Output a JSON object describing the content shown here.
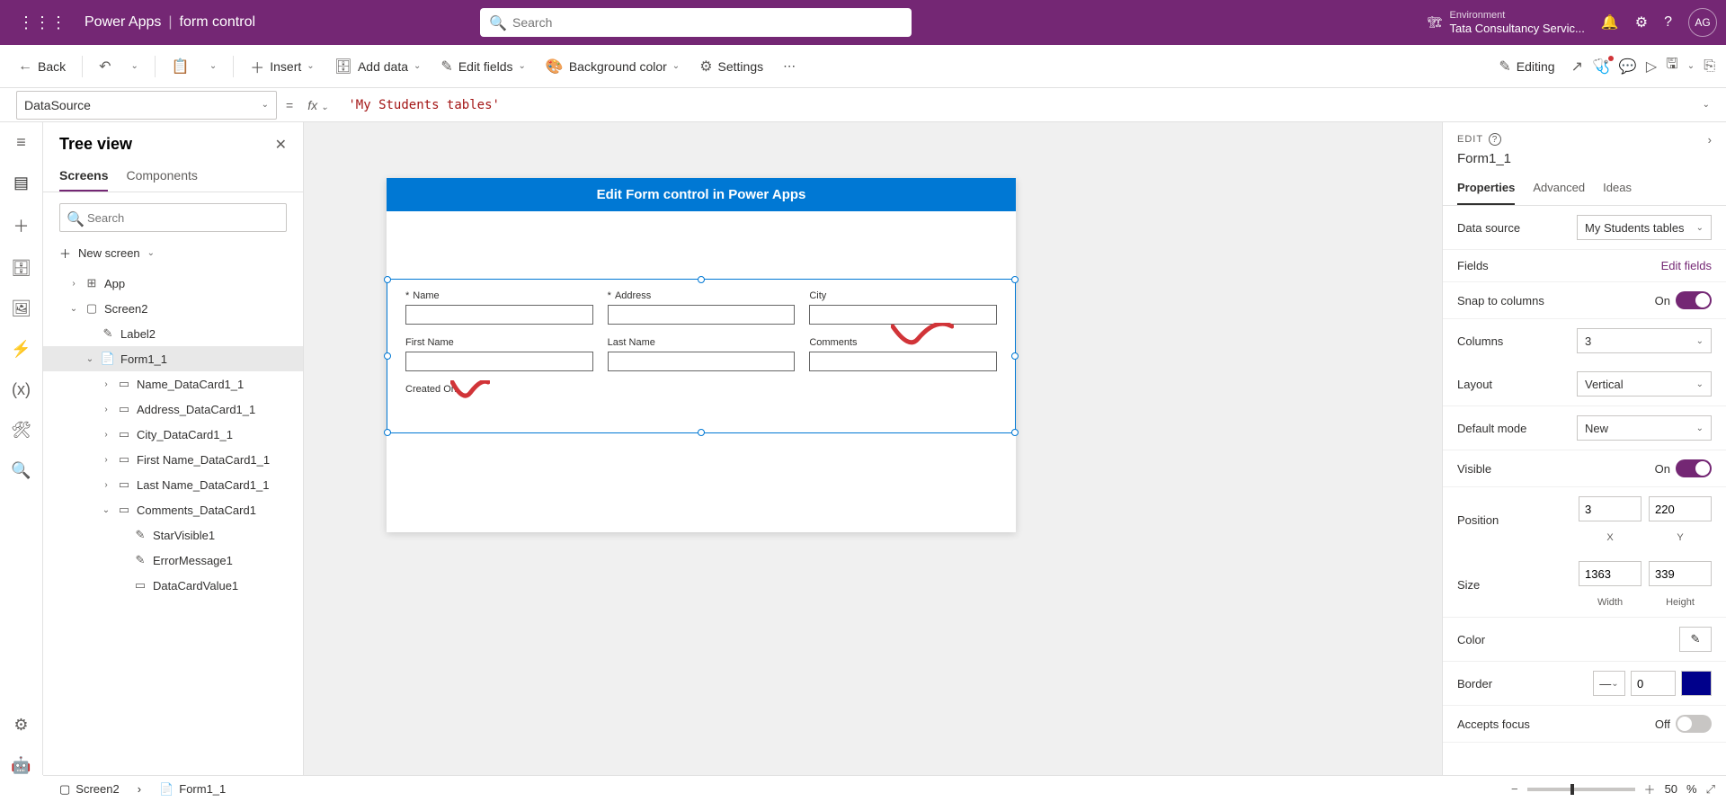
{
  "topbar": {
    "app_name": "Power Apps",
    "separator": "|",
    "file_name": "form control",
    "search_placeholder": "Search",
    "env_label": "Environment",
    "env_name": "Tata Consultancy Servic...",
    "avatar_initials": "AG"
  },
  "toolbar": {
    "back": "Back",
    "insert": "Insert",
    "add_data": "Add data",
    "edit_fields": "Edit fields",
    "bg_color": "Background color",
    "settings": "Settings",
    "editing": "Editing"
  },
  "formula": {
    "property": "DataSource",
    "fx": "fx",
    "value": "'My Students tables'"
  },
  "tree": {
    "title": "Tree view",
    "tabs": {
      "screens": "Screens",
      "components": "Components"
    },
    "search_placeholder": "Search",
    "new_screen": "New screen",
    "items": {
      "app": "App",
      "screen2": "Screen2",
      "label2": "Label2",
      "form1_1": "Form1_1",
      "name_dc": "Name_DataCard1_1",
      "address_dc": "Address_DataCard1_1",
      "city_dc": "City_DataCard1_1",
      "firstname_dc": "First Name_DataCard1_1",
      "lastname_dc": "Last Name_DataCard1_1",
      "comments_dc": "Comments_DataCard1",
      "starvisible": "StarVisible1",
      "errormsg": "ErrorMessage1",
      "datacardvalue": "DataCardValue1"
    }
  },
  "canvas": {
    "header_title": "Edit Form control in Power Apps",
    "labels": {
      "name": "Name",
      "address": "Address",
      "city": "City",
      "first_name": "First Name",
      "last_name": "Last Name",
      "comments": "Comments",
      "created_on": "Created On"
    }
  },
  "props": {
    "edit_label": "EDIT",
    "control_name": "Form1_1",
    "tabs": {
      "properties": "Properties",
      "advanced": "Advanced",
      "ideas": "Ideas"
    },
    "data_source_label": "Data source",
    "data_source_value": "My Students tables",
    "fields_label": "Fields",
    "edit_fields_link": "Edit fields",
    "snap_label": "Snap to columns",
    "snap_value": "On",
    "columns_label": "Columns",
    "columns_value": "3",
    "layout_label": "Layout",
    "layout_value": "Vertical",
    "default_mode_label": "Default mode",
    "default_mode_value": "New",
    "visible_label": "Visible",
    "visible_value": "On",
    "position_label": "Position",
    "position_x": "3",
    "position_y": "220",
    "x_label": "X",
    "y_label": "Y",
    "size_label": "Size",
    "size_w": "1363",
    "size_h": "339",
    "width_label": "Width",
    "height_label": "Height",
    "color_label": "Color",
    "border_label": "Border",
    "border_value": "0",
    "accepts_focus_label": "Accepts focus",
    "accepts_focus_value": "Off"
  },
  "status": {
    "screen": "Screen2",
    "form": "Form1_1",
    "zoom": "50",
    "zoom_pct": "%"
  }
}
